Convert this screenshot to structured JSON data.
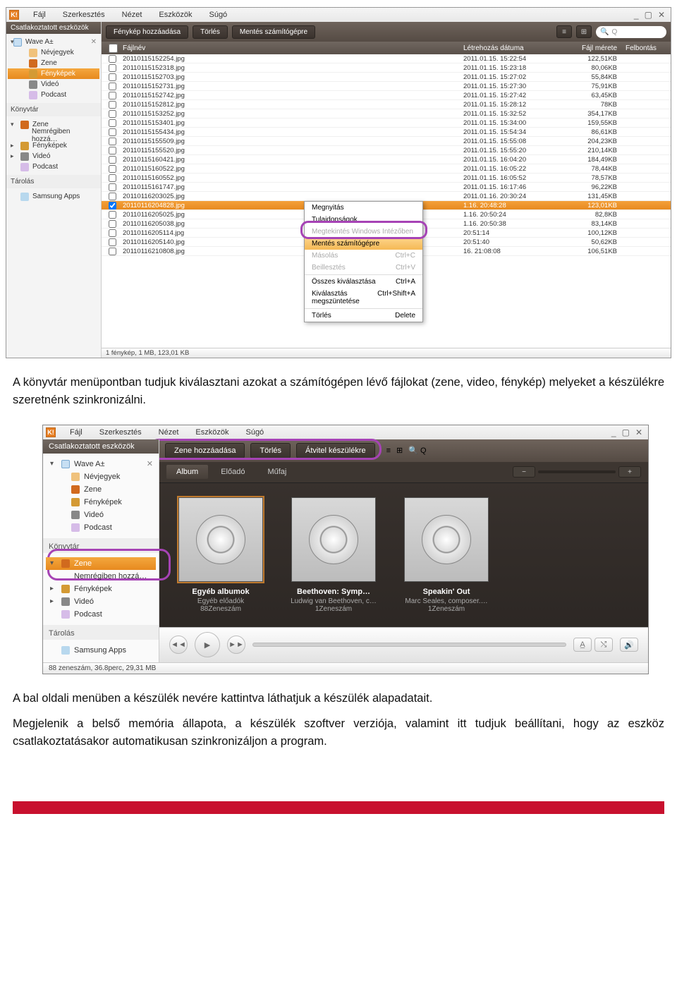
{
  "menubar": {
    "items": [
      "Fájl",
      "Szerkesztés",
      "Nézet",
      "Eszközök",
      "Súgó"
    ],
    "logo": "K!"
  },
  "winctrl": {
    "min": "_",
    "max": "▢",
    "close": "✕"
  },
  "screenshot1": {
    "sidebar": {
      "title": "Csatlakoztatott eszközök",
      "device": "Wave A±",
      "items": [
        {
          "label": "Névjegyek",
          "icon": "contacts"
        },
        {
          "label": "Zene",
          "icon": "music"
        },
        {
          "label": "Fényképek",
          "icon": "photo",
          "selected": true
        },
        {
          "label": "Videó",
          "icon": "video"
        },
        {
          "label": "Podcast",
          "icon": "podcast"
        }
      ],
      "library_title": "Könyvtár",
      "library": [
        {
          "label": "Zene",
          "icon": "music",
          "expandable": true,
          "expanded": true
        },
        {
          "label": "Nemrégiben hozzá…",
          "indent": true
        },
        {
          "label": "Fényképek",
          "icon": "photo",
          "expandable": true
        },
        {
          "label": "Videó",
          "icon": "video",
          "expandable": true
        },
        {
          "label": "Podcast",
          "icon": "podcast"
        }
      ],
      "storage_title": "Tárolás",
      "storage": [
        {
          "label": "Samsung Apps",
          "icon": "samsung"
        }
      ]
    },
    "toolbar": {
      "buttons": [
        "Fénykép hozzáadása",
        "Törlés",
        "Mentés számítógépre"
      ],
      "search_placeholder": "Q"
    },
    "columns": {
      "check": "",
      "name": "Fájlnév",
      "date": "Létrehozás dátuma",
      "size": "Fájl mérete",
      "res": "Felbontás"
    },
    "rows": [
      {
        "name": "20110115152254.jpg",
        "date": "2011.01.15. 15:22:54",
        "size": "122,51KB"
      },
      {
        "name": "20110115152318.jpg",
        "date": "2011.01.15. 15:23:18",
        "size": "80,06KB"
      },
      {
        "name": "20110115152703.jpg",
        "date": "2011.01.15. 15:27:02",
        "size": "55,84KB"
      },
      {
        "name": "20110115152731.jpg",
        "date": "2011.01.15. 15:27:30",
        "size": "75,91KB"
      },
      {
        "name": "20110115152742.jpg",
        "date": "2011.01.15. 15:27:42",
        "size": "63,45KB"
      },
      {
        "name": "20110115152812.jpg",
        "date": "2011.01.15. 15:28:12",
        "size": "78KB"
      },
      {
        "name": "20110115153252.jpg",
        "date": "2011.01.15. 15:32:52",
        "size": "354,17KB"
      },
      {
        "name": "20110115153401.jpg",
        "date": "2011.01.15. 15:34:00",
        "size": "159,55KB"
      },
      {
        "name": "20110115155434.jpg",
        "date": "2011.01.15. 15:54:34",
        "size": "86,61KB"
      },
      {
        "name": "20110115155509.jpg",
        "date": "2011.01.15. 15:55:08",
        "size": "204,23KB"
      },
      {
        "name": "20110115155520.jpg",
        "date": "2011.01.15. 15:55:20",
        "size": "210,14KB"
      },
      {
        "name": "20110115160421.jpg",
        "date": "2011.01.15. 16:04:20",
        "size": "184,49KB"
      },
      {
        "name": "20110115160522.jpg",
        "date": "2011.01.15. 16:05:22",
        "size": "78,44KB"
      },
      {
        "name": "20110115160552.jpg",
        "date": "2011.01.15. 16:05:52",
        "size": "78,57KB"
      },
      {
        "name": "20110115161747.jpg",
        "date": "2011.01.15. 16:17:46",
        "size": "96,22KB"
      },
      {
        "name": "20110116203025.jpg",
        "date": "2011.01.16. 20:30:24",
        "size": "131,45KB"
      },
      {
        "name": "20110116204828.jpg",
        "date": "1.16. 20:48:28",
        "size": "123,01KB",
        "selected": true,
        "checked": true
      },
      {
        "name": "20110116205025.jpg",
        "date": "1.16. 20:50:24",
        "size": "82,8KB"
      },
      {
        "name": "20110116205038.jpg",
        "date": "1.16. 20:50:38",
        "size": "83,14KB"
      },
      {
        "name": "20110116205114.jpg",
        "date": "20:51:14",
        "size": "100,12KB"
      },
      {
        "name": "20110116205140.jpg",
        "date": "20:51:40",
        "size": "50,62KB"
      },
      {
        "name": "20110116210808.jpg",
        "date": "16. 21:08:08",
        "size": "106,51KB"
      }
    ],
    "context": [
      {
        "label": "Megnyitás"
      },
      {
        "label": "Tulajdonságok"
      },
      {
        "label": "Megtekintés Windows Intézőben",
        "disabled": true
      },
      {
        "label": "Mentés számítógépre",
        "hl": true
      },
      {
        "label": "Másolás",
        "shortcut": "Ctrl+C",
        "disabled": true
      },
      {
        "label": "Beillesztés",
        "shortcut": "Ctrl+V",
        "disabled": true
      },
      {
        "sep": true
      },
      {
        "label": "Összes kiválasztása",
        "shortcut": "Ctrl+A"
      },
      {
        "label": "Kiválasztás megszüntetése",
        "shortcut": "Ctrl+Shift+A"
      },
      {
        "sep": true
      },
      {
        "label": "Törlés",
        "shortcut": "Delete"
      }
    ],
    "status": "1 fénykép, 1 MB, 123,01 KB"
  },
  "para1": "A könyvtár menüpontban tudjuk kiválasztani azokat a számítógépen lévő fájlokat (zene, video, fénykép) melyeket a készülékre szeretnénk szinkronizálni.",
  "screenshot2": {
    "toolbar": {
      "buttons": [
        "Zene hozzáadása",
        "Törlés",
        "Átvitel készülékre"
      ],
      "search": "Q"
    },
    "tabs": [
      "Album",
      "Előadó",
      "Műfaj"
    ],
    "albums": [
      {
        "title": "Egyéb albumok",
        "sub1": "Egyéb előadók",
        "sub2": "88Zeneszám"
      },
      {
        "title": "Beethoven: Symp…",
        "sub1": "Ludwig van Beethoven, c…",
        "sub2": "1Zeneszám"
      },
      {
        "title": "Speakin' Out",
        "sub1": "Marc Seales, composer.…",
        "sub2": "1Zeneszám"
      }
    ],
    "sidebar": {
      "title": "Csatlakoztatott eszközök",
      "device": "Wave A±",
      "items": [
        {
          "label": "Névjegyek",
          "icon": "contacts"
        },
        {
          "label": "Zene",
          "icon": "music"
        },
        {
          "label": "Fényképek",
          "icon": "photo"
        },
        {
          "label": "Videó",
          "icon": "video"
        },
        {
          "label": "Podcast",
          "icon": "podcast"
        }
      ],
      "library_title": "Könyvtár",
      "library": [
        {
          "label": "Zene",
          "icon": "music",
          "selected": true,
          "expandable": true,
          "expanded": true
        },
        {
          "label": "Nemrégiben hozzá…",
          "indent": true
        },
        {
          "label": "Fényképek",
          "icon": "photo",
          "expandable": true
        },
        {
          "label": "Videó",
          "icon": "video",
          "expandable": true
        },
        {
          "label": "Podcast",
          "icon": "podcast"
        }
      ],
      "storage_title": "Tárolás",
      "storage": [
        {
          "label": "Samsung Apps",
          "icon": "samsung"
        }
      ]
    },
    "status": "88 zeneszám, 36.8perc, 29,31 MB"
  },
  "para2": "A bal oldali menüben a készülék nevére kattintva láthatjuk a készülék alapadatait.",
  "para3": "Megjelenik a belső memória állapota, a készülék szoftver verziója, valamint itt tudjuk beállítani, hogy az eszköz csatlakoztatásakor automatikusan szinkronizáljon a program."
}
